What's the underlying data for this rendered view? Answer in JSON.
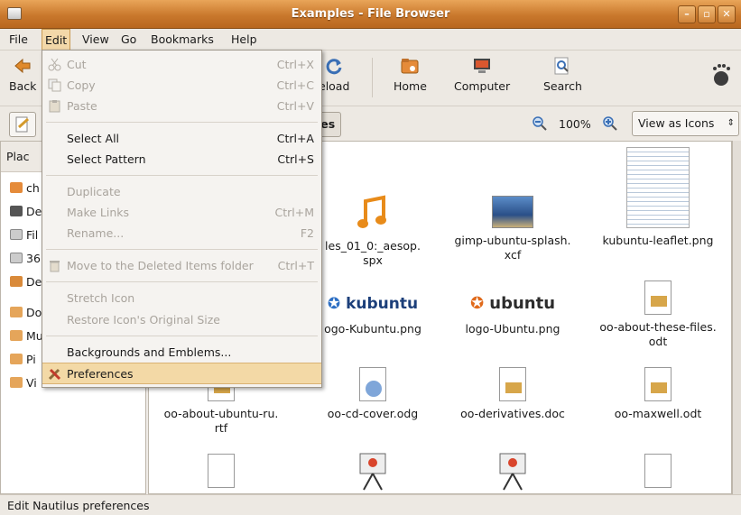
{
  "window": {
    "title": "Examples - File Browser"
  },
  "menubar": {
    "file": "File",
    "edit": "Edit",
    "view": "View",
    "go": "Go",
    "bookmarks": "Bookmarks",
    "help": "Help"
  },
  "toolbar": {
    "back": "Back",
    "reload": "eload",
    "home": "Home",
    "computer": "Computer",
    "search": "Search"
  },
  "location": {
    "crumb": "les",
    "zoom": "100%",
    "view_mode": "View as Icons"
  },
  "sidebar": {
    "header": "Plac",
    "items": [
      "ch",
      "De",
      "Fil",
      "36",
      "De",
      "Do",
      "Mu",
      "Pi",
      "Vi"
    ]
  },
  "files": [
    {
      "name": "les_01_0:_aesop.",
      "name2": "spx"
    },
    {
      "name": "gimp-ubuntu-splash.",
      "name2": "xcf"
    },
    {
      "name": "kubuntu-leaflet.png",
      "name2": ""
    },
    {
      "name": "ogo-Kubuntu.png",
      "name2": "",
      "logo": "kubuntu"
    },
    {
      "name": "logo-Ubuntu.png",
      "name2": "",
      "logo": "ubuntu"
    },
    {
      "name": "oo-about-these-files.",
      "name2": "odt"
    },
    {
      "name": "oo-about-ubuntu-ru.",
      "name2": "rtf"
    },
    {
      "name": "oo-cd-cover.odg",
      "name2": ""
    },
    {
      "name": "oo-derivatives.doc",
      "name2": ""
    },
    {
      "name": "oo-maxwell.odt",
      "name2": ""
    }
  ],
  "edit_menu": {
    "cut": "Cut",
    "cut_acc": "Ctrl+X",
    "copy": "Copy",
    "copy_acc": "Ctrl+C",
    "paste": "Paste",
    "paste_acc": "Ctrl+V",
    "select_all": "Select All",
    "select_all_acc": "Ctrl+A",
    "select_pattern": "Select Pattern",
    "select_pattern_acc": "Ctrl+S",
    "duplicate": "Duplicate",
    "make_links": "Make Links",
    "make_links_acc": "Ctrl+M",
    "rename": "Rename...",
    "rename_acc": "F2",
    "move_trash": "Move to the Deleted Items folder",
    "move_trash_acc": "Ctrl+T",
    "stretch": "Stretch Icon",
    "restore": "Restore Icon's Original Size",
    "backgrounds": "Backgrounds and Emblems...",
    "preferences": "Preferences"
  },
  "status": {
    "text": "Edit Nautilus preferences"
  },
  "colors": {
    "title_orange": "#c9782c",
    "highlight": "#f3d9a6"
  }
}
